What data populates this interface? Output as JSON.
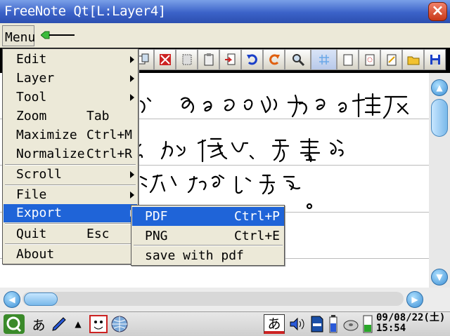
{
  "window": {
    "title": "FreeNote Qt[L:Layer4]",
    "close_label": "×"
  },
  "menubar": {
    "menu_label": "Menu"
  },
  "toolbar": {
    "icons": [
      "copy-icon",
      "select-icon",
      "paste-icon",
      "clipboard-icon",
      "insert-icon",
      "undo-icon",
      "redo-icon",
      "zoom-icon",
      "grid-icon",
      "new-page-icon",
      "template-icon",
      "edit-icon",
      "open-folder-icon",
      "save-icon"
    ]
  },
  "menu": {
    "items": [
      {
        "label": "Edit",
        "accel": "",
        "submenu": true
      },
      {
        "label": "Layer",
        "accel": "",
        "submenu": true
      },
      {
        "label": "Tool",
        "accel": "",
        "submenu": true
      },
      {
        "label": "Zoom",
        "accel": "Tab",
        "submenu": false
      },
      {
        "label": "Maximize",
        "accel": "Ctrl+M",
        "submenu": false
      },
      {
        "label": "Normalize",
        "accel": "Ctrl+R",
        "submenu": false
      },
      {
        "label": "Scroll",
        "accel": "",
        "submenu": true
      },
      {
        "label": "File",
        "accel": "",
        "submenu": true
      },
      {
        "label": "Export",
        "accel": "",
        "submenu": true,
        "highlighted": true
      },
      {
        "label": "Quit",
        "accel": "Esc",
        "submenu": false
      },
      {
        "label": "About",
        "accel": "",
        "submenu": false
      }
    ]
  },
  "export_submenu": {
    "items": [
      {
        "label": "PDF",
        "accel": "Ctrl+P",
        "highlighted": true
      },
      {
        "label": "PNG",
        "accel": "Ctrl+E"
      },
      {
        "label": "save with pdf",
        "accel": ""
      }
    ]
  },
  "canvas": {
    "note_text": "あるのびある程度 お陰で、手書き 楽に浴ります。"
  },
  "taskbar": {
    "ime_label": "あ",
    "ime2_label": "あ",
    "date": "09/08/22(土)",
    "time": "15:54"
  },
  "colors": {
    "title_bar": "#3b62c8",
    "highlight": "#1f64d8",
    "menu_bg": "#ece9d8",
    "scroll_accent": "#3d8fd4"
  }
}
